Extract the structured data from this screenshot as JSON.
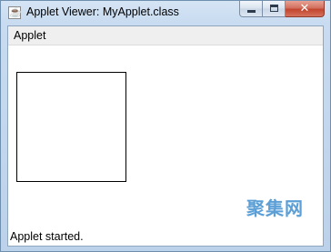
{
  "window": {
    "title": "Applet Viewer: MyApplet.class",
    "icon": "java-icon",
    "icon_glyph": "☕",
    "close_glyph": "✕"
  },
  "menu": {
    "items": [
      {
        "label": "Applet"
      }
    ]
  },
  "status": {
    "text": "Applet started."
  },
  "watermark": {
    "text": "聚集网"
  },
  "colors": {
    "titlebar": "#c8dbf0",
    "close_button": "#c2452e",
    "menubar": "#efefef",
    "canvas_border": "#000000"
  }
}
